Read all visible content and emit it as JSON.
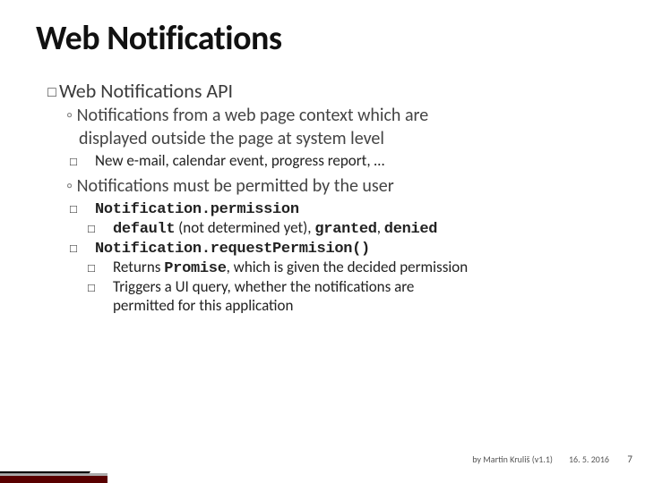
{
  "title": "Web Notifications",
  "l1_prefix": "Web",
  "l1_rest": " Notifications API",
  "l2a_a": "Notifications from a web page context which are",
  "l2a_b": "displayed outside the page at system level",
  "l3a": "New e-mail, calendar event, progress report, …",
  "l2b": "Notifications must be permitted by the user",
  "l3b": "Notification.permission",
  "l4b_pre": "default",
  "l4b_mid": " (not determined yet), ",
  "l4b_g": "granted",
  "l4b_c": ", ",
  "l4b_d": "denied",
  "l3c": "Notification.requestPermision()",
  "l4c_a": "Returns ",
  "l4c_b": "Promise",
  "l4c_c": ", which is given the decided permission",
  "l4d_a": "Triggers a UI query, whether the notifications are",
  "l4d_b": "permitted for this application",
  "footer_author": "by Martin Kruliš (v1.1)",
  "footer_date": "16. 5. 2016",
  "page": "7"
}
